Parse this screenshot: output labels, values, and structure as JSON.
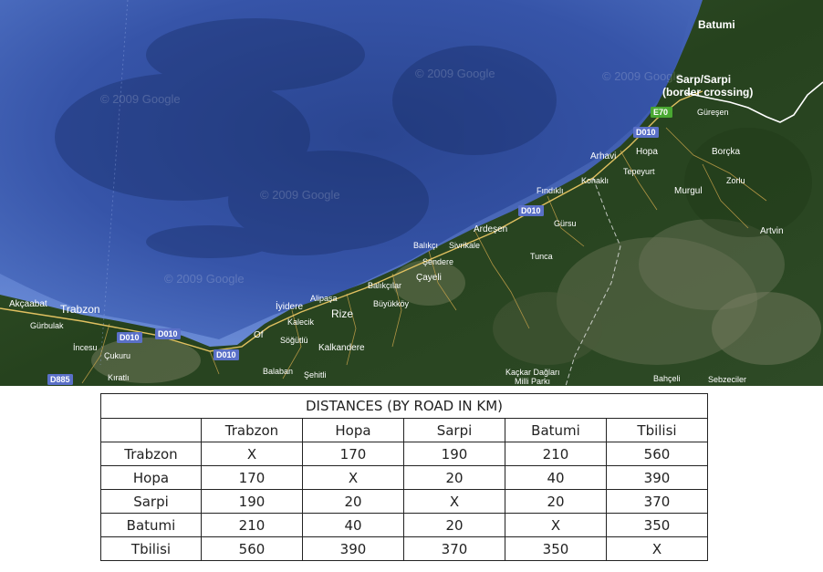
{
  "map": {
    "places": [
      {
        "id": "batumi",
        "name": "Batumi"
      },
      {
        "id": "sarp",
        "name": "Sarp/Sarpi"
      },
      {
        "id": "border",
        "name": "(border crossing)"
      },
      {
        "id": "guresen",
        "name": "Güreşen"
      },
      {
        "id": "hopa",
        "name": "Hopa"
      },
      {
        "id": "borcka",
        "name": "Borçka"
      },
      {
        "id": "arhavi",
        "name": "Arhavi"
      },
      {
        "id": "tepeyurt",
        "name": "Tepeyurt"
      },
      {
        "id": "konakli",
        "name": "Konaklı"
      },
      {
        "id": "murgul",
        "name": "Murgul"
      },
      {
        "id": "zorlu",
        "name": "Zorlu"
      },
      {
        "id": "findikli",
        "name": "Fındıklı"
      },
      {
        "id": "gursu",
        "name": "Gürsu"
      },
      {
        "id": "artvin",
        "name": "Artvin"
      },
      {
        "id": "ardesen",
        "name": "Ardeşen"
      },
      {
        "id": "balikci",
        "name": "Balıkçı"
      },
      {
        "id": "sivrikale",
        "name": "Sivrikale"
      },
      {
        "id": "tunca",
        "name": "Tunca"
      },
      {
        "id": "sendere",
        "name": "Şendere"
      },
      {
        "id": "cayeli",
        "name": "Çayeli"
      },
      {
        "id": "balikcilar",
        "name": "Balıkçılar"
      },
      {
        "id": "alipasa",
        "name": "Alipaşa"
      },
      {
        "id": "buyukkoy",
        "name": "Büyükköy"
      },
      {
        "id": "iyidere",
        "name": "İyidere"
      },
      {
        "id": "rize",
        "name": "Rize"
      },
      {
        "id": "kalecik",
        "name": "Kalecik"
      },
      {
        "id": "sogutlu",
        "name": "Söğütlü"
      },
      {
        "id": "of",
        "name": "Of"
      },
      {
        "id": "kalkandere",
        "name": "Kalkandere"
      },
      {
        "id": "akcaabat",
        "name": "Akçaabat"
      },
      {
        "id": "trabzon",
        "name": "Trabzon"
      },
      {
        "id": "gurbulak",
        "name": "Gürbulak"
      },
      {
        "id": "incesu",
        "name": "İncesu"
      },
      {
        "id": "cukuru",
        "name": "Çukuru"
      },
      {
        "id": "kiratli",
        "name": "Kıratlı"
      },
      {
        "id": "balaban",
        "name": "Balaban"
      },
      {
        "id": "sehitli",
        "name": "Şehitli"
      },
      {
        "id": "kackar1",
        "name": "Kaçkar Dağları"
      },
      {
        "id": "kackar2",
        "name": "Milli Parkı"
      },
      {
        "id": "bahceli",
        "name": "Bahçeli"
      },
      {
        "id": "sebzeciler",
        "name": "Sebzeciler"
      }
    ],
    "road_shields": {
      "e70": "E70",
      "d010": "D010",
      "d885": "D885"
    },
    "watermark": "© 2009 Google",
    "colors": {
      "sea_light": "#4a6bc0",
      "sea_dark": "#1f3a8a",
      "land": "#2b4a22",
      "road_shield": "#5a70c8",
      "e_shield": "#4aa832",
      "border_line": "#ffffff"
    }
  },
  "table": {
    "title": "DISTANCES (BY ROAD IN KM)",
    "columns": [
      "Trabzon",
      "Hopa",
      "Sarpi",
      "Batumi",
      "Tbilisi"
    ],
    "rows": [
      {
        "name": "Trabzon",
        "values": [
          "X",
          "170",
          "190",
          "210",
          "560"
        ]
      },
      {
        "name": "Hopa",
        "values": [
          "170",
          "X",
          "20",
          "40",
          "390"
        ]
      },
      {
        "name": "Sarpi",
        "values": [
          "190",
          "20",
          "X",
          "20",
          "370"
        ]
      },
      {
        "name": "Batumi",
        "values": [
          "210",
          "40",
          "20",
          "X",
          "350"
        ]
      },
      {
        "name": "Tbilisi",
        "values": [
          "560",
          "390",
          "370",
          "350",
          "X"
        ]
      }
    ]
  }
}
